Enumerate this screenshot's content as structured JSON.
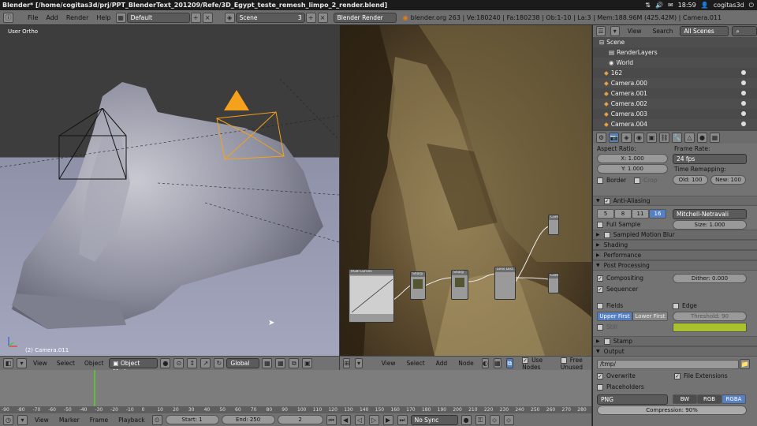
{
  "window": {
    "title": "Blender* [/home/cogitas3d/prj/PPT_BlenderText_201209/Refe/3D_Egypt_teste_remesh_limpo_2_render.blend]",
    "clock": "18:59",
    "user": "cogitas3d"
  },
  "info": {
    "menus": [
      "File",
      "Add",
      "Render",
      "Help"
    ],
    "layout": "Default",
    "scene": "Scene",
    "scene_count": "3",
    "engine": "Blender Render",
    "stats": "blender.org 263 | Ve:180240 | Fa:180238 | Ob:1-10 | La:3 | Mem:188.96M (425.42M) | Camera.011"
  },
  "viewport3d": {
    "view_name": "User Ortho",
    "object_label": "(2) Camera.011",
    "menus": [
      "View",
      "Select",
      "Object"
    ],
    "mode": "Object Mode",
    "orientation": "Global"
  },
  "node_editor": {
    "menus": [
      "View",
      "Select",
      "Add",
      "Node"
    ],
    "use_nodes_label": "Use Nodes",
    "use_nodes": true,
    "free_unused_label": "Free Unused",
    "free_unused": false,
    "nodes": {
      "curves": "RGB Curves",
      "sharpen_a": "Sharp",
      "sharpen_b": "Sharp",
      "render_layers": "Lens Dist",
      "composite": "Comp"
    }
  },
  "timeline": {
    "ruler_ticks": [
      "-90",
      "-80",
      "-70",
      "-60",
      "-50",
      "-40",
      "-30",
      "-20",
      "-10",
      "0",
      "10",
      "20",
      "30",
      "40",
      "50",
      "60",
      "70",
      "80",
      "90",
      "100",
      "110",
      "120",
      "130",
      "140",
      "150",
      "160",
      "170",
      "180",
      "190",
      "200",
      "210",
      "220",
      "230",
      "240",
      "250",
      "260",
      "270",
      "280"
    ],
    "current_frame_marker": 0,
    "menus": [
      "View",
      "Marker",
      "Frame",
      "Playback"
    ],
    "start": "Start: 1",
    "end": "End: 250",
    "current": "2",
    "sync": "No Sync"
  },
  "outliner": {
    "menus": [
      "View",
      "Search"
    ],
    "filter": "All Scenes",
    "items": [
      "Scene",
      "RenderLayers",
      "World",
      "162",
      "Camera.000",
      "Camera.001",
      "Camera.002",
      "Camera.003",
      "Camera.004"
    ]
  },
  "properties": {
    "aspect_ratio_label": "Aspect Ratio:",
    "aspect_x": "X: 1.000",
    "aspect_y": "Y: 1.000",
    "frame_rate_label": "Frame Rate:",
    "frame_rate": "24 fps",
    "time_remap_label": "Time Remapping:",
    "old": "Old: 100",
    "new": "New: 100",
    "border_label": "Border",
    "crop_label": "Crop",
    "aa_label": "Anti-Aliasing",
    "aa_samples": [
      "5",
      "8",
      "11",
      "16"
    ],
    "aa_selected": "16",
    "aa_filter": "Mitchell-Netravali",
    "full_sample_label": "Full Sample",
    "size_label": "Size: 1.000",
    "panels_collapsed": [
      "Sampled Motion Blur",
      "Shading",
      "Performance"
    ],
    "post_processing_label": "Post Processing",
    "compositing_label": "Compositing",
    "sequencer_label": "Sequencer",
    "dither": "Dither: 0.000",
    "fields_label": "Fields",
    "edge_label": "Edge",
    "upper_first": "Upper First",
    "lower_first": "Lower First",
    "threshold": "Threshold: 90",
    "still_label": "Still",
    "edge_color": "#a9c12e",
    "stamp_label": "Stamp",
    "output_label": "Output",
    "output_path": "/tmp/",
    "overwrite_label": "Overwrite",
    "file_ext_label": "File Extensions",
    "placeholders_label": "Placeholders",
    "format": "PNG",
    "color_modes": [
      "BW",
      "RGB",
      "RGBA"
    ],
    "color_mode_selected": "RGBA",
    "compression": "Compression: 90%"
  },
  "colors": {
    "accent_blue": "#5680c2",
    "camera_orange": "#f5a11b",
    "frame_marker": "#5fbf3a"
  }
}
